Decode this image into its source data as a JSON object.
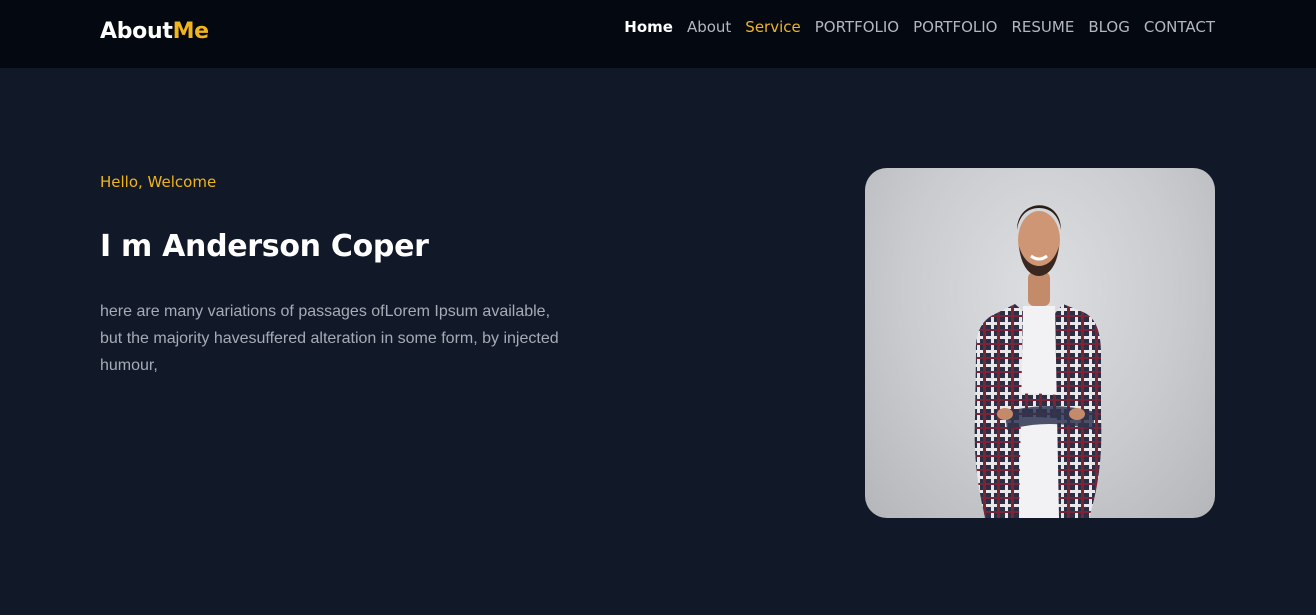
{
  "header": {
    "brand_part1": "About",
    "brand_part2": "Me",
    "nav": [
      {
        "label": "Home"
      },
      {
        "label": "About"
      },
      {
        "label": "Service"
      },
      {
        "label": "PORTFOLIO"
      },
      {
        "label": "PORTFOLIO"
      },
      {
        "label": "RESUME"
      },
      {
        "label": "BLOG"
      },
      {
        "label": "CONTACT"
      }
    ]
  },
  "hero": {
    "greeting": "Hello, Welcome",
    "title": "I m Anderson Coper",
    "description": "here are many variations of passages ofLorem Ipsum available, but the majority havesuffered alteration in some form, by injected humour,",
    "photo_subject": "smiling bearded man in plaid shirt with arms crossed"
  },
  "colors": {
    "accent": "#f0b41e",
    "background": "#111827",
    "header_background": "#040810"
  }
}
